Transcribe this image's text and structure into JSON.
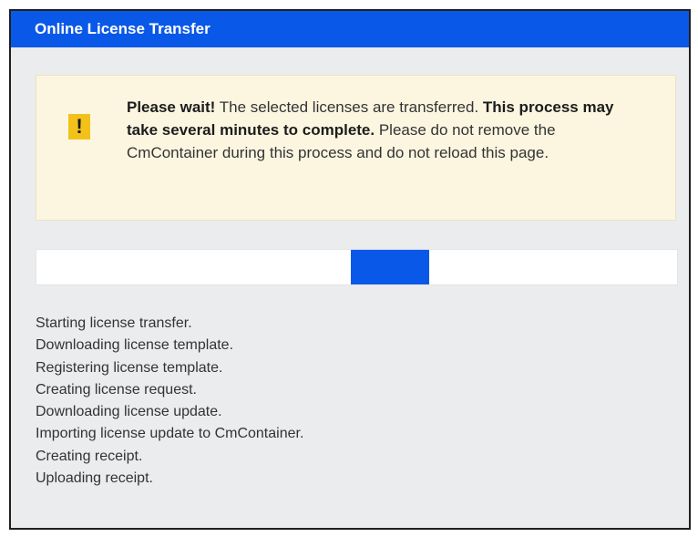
{
  "window": {
    "title": "Online License Transfer"
  },
  "alert": {
    "icon": "warning-exclamation-icon",
    "icon_glyph": "!",
    "lead_bold": "Please wait!",
    "lead_text": " The selected licenses are transferred. ",
    "emphasis_bold": "This process may take several minutes to complete.",
    "trailing_text": " Please do not remove the CmContainer during this process and do not reload this page."
  },
  "progress": {
    "indeterminate": true,
    "fill_color": "#0a58e8"
  },
  "log": [
    "Starting license transfer.",
    "Downloading license template.",
    "Registering license template.",
    "Creating license request.",
    "Downloading license update.",
    "Importing license update to CmContainer.",
    "Creating receipt.",
    "Uploading receipt."
  ],
  "colors": {
    "accent": "#0a58e8",
    "alert_background": "#fcf6e1",
    "warning_icon": "#f2c11a",
    "panel_background": "#eaecee"
  }
}
